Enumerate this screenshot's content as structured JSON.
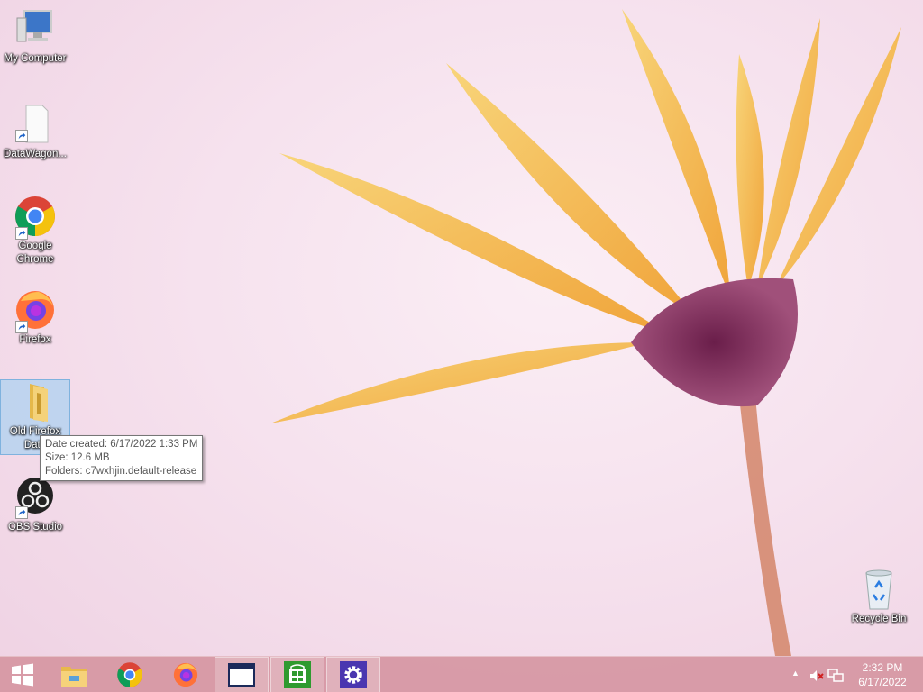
{
  "desktop": {
    "icons": [
      {
        "label": "My Computer",
        "icon": "computer-icon"
      },
      {
        "label": "DataWagon...",
        "icon": "document-icon"
      },
      {
        "label": "Google Chrome",
        "icon": "chrome-icon"
      },
      {
        "label": "Firefox",
        "icon": "firefox-icon"
      },
      {
        "label": "Old Firefox Data",
        "icon": "folder-icon"
      },
      {
        "label": "OBS Studio",
        "icon": "obs-icon"
      },
      {
        "label": "Recycle Bin",
        "icon": "recycle-bin-icon"
      }
    ]
  },
  "tooltip": {
    "date_created": "Date created: 6/17/2022 1:33 PM",
    "size": "Size: 12.6 MB",
    "folders": "Folders: c7wxhjin.default-release"
  },
  "taskbar": {
    "buttons": [
      {
        "icon": "windows-start-icon"
      },
      {
        "icon": "file-explorer-icon"
      },
      {
        "icon": "chrome-icon"
      },
      {
        "icon": "firefox-icon"
      },
      {
        "icon": "window-icon"
      },
      {
        "icon": "store-icon"
      },
      {
        "icon": "settings-gear-icon"
      }
    ],
    "tray": {
      "show_hidden": "▲",
      "time": "2:32 PM",
      "date": "6/17/2022"
    }
  },
  "colors": {
    "taskbar": "#d696a2",
    "selection": "#add2f0",
    "settings_tile": "#4a36b0",
    "store_tile": "#2f9a2f"
  }
}
